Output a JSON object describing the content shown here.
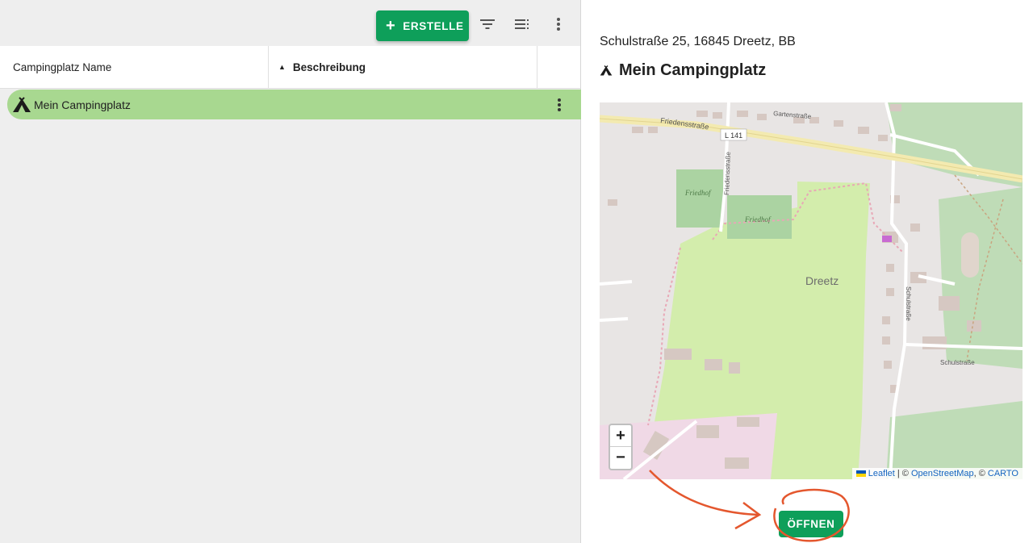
{
  "toolbar": {
    "create_label": "ERSTELLE",
    "icons": [
      "filter-icon",
      "view-columns-icon",
      "more-vert-icon"
    ]
  },
  "table": {
    "columns": [
      "Campingplatz Name",
      "Beschreibung"
    ],
    "sorted_column": "Beschreibung",
    "rows": [
      {
        "name": "Mein Campingplatz",
        "selected": true
      }
    ]
  },
  "detail": {
    "address": "Schulstraße 25, 16845 Dreetz, BB",
    "title": "Mein Campingplatz",
    "open_label": "ÖFFNEN"
  },
  "map": {
    "labels": {
      "place": "Dreetz",
      "road_main": "Friedensstraße",
      "road_ref": "L 141",
      "road_side": "Friedensstraße",
      "garten": "Gartenstraße",
      "friedhof_1": "Friedhof",
      "friedhof_2": "Friedhof",
      "schul_v": "Schulstraße",
      "schul_h": "Schulstraße"
    },
    "zoom_in": "+",
    "zoom_out": "−",
    "attribution": {
      "leaflet": "Leaflet",
      "sep": " | © ",
      "osm": "OpenStreetMap",
      "sep2": ", © ",
      "carto": "CARTO"
    }
  },
  "colors": {
    "accent": "#0e9f5a",
    "row_selected": "#a8d890",
    "annotation": "#e4572e"
  }
}
